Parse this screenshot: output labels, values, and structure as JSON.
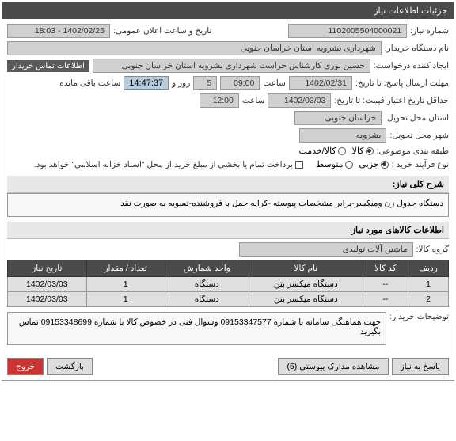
{
  "header": {
    "title": "جزئیات اطلاعات نیاز"
  },
  "fields": {
    "need_no_label": "شماره نیاز:",
    "need_no": "1102005504000021",
    "public_date_label": "تاریخ و ساعت اعلان عمومی:",
    "public_date": "1402/02/25 - 18:03",
    "buyer_label": "نام دستگاه خریدار:",
    "buyer": "شهرداری بشرویه استان خراسان جنوبی",
    "creator_label": "ایجاد کننده درخواست:",
    "creator": "حسین نوری کارشناس حراست شهرداری بشرویه استان خراسان جنوبی",
    "contact_label": "اطلاعات تماس خریدار",
    "deadline_label": "مهلت ارسال پاسخ: تا تاریخ:",
    "deadline_date": "1402/02/31",
    "time_label": "ساعت",
    "deadline_time": "09:00",
    "day_label": "روز و",
    "days_remain": "5",
    "countdown": "14:47:37",
    "remain_label": "ساعت باقی مانده",
    "validity_label": "حداقل تاریخ اعتبار قیمت: تا تاریخ:",
    "validity_date": "1402/03/03",
    "validity_time": "12:00",
    "province_label": "استان محل تحویل:",
    "province": "خراسان جنوبی",
    "city_label": "شهر محل تحویل:",
    "city": "بشرویه",
    "category_label": "طبقه بندی موضوعی:",
    "cat_goods": "کالا",
    "cat_service": "کالا/خدمت",
    "process_label": "نوع فرآیند خرید :",
    "proc_small": "جزیی",
    "proc_medium": "متوسط",
    "payment_note": "پرداخت تمام یا بخشی از مبلغ خرید،از محل \"اسناد خزانه اسلامی\" خواهد بود.",
    "desc_label": "شرح کلی نیاز:",
    "desc_text": "دستگاه جدول زن ومیکسر-برابر مشخصات پیوسته -کرایه حمل با فروشنده-تسویه به صورت نقد",
    "items_section": "اطلاعات کالاهای مورد نیاز",
    "group_label": "گروه کالا:",
    "group_value": "ماشین آلات تولیدی",
    "notes_label": "توضیحات خریدار:",
    "notes_text": "جهت هماهنگی سامانه با شماره 09153347577 وسوال فنی در خصوص کالا با شماره 09153348699 تماس بگیرید"
  },
  "table": {
    "headers": [
      "ردیف",
      "کد کالا",
      "نام کالا",
      "واحد شمارش",
      "تعداد / مقدار",
      "تاریخ نیاز"
    ],
    "rows": [
      [
        "1",
        "--",
        "دستگاه میکسر بتن",
        "دستگاه",
        "1",
        "1402/03/03"
      ],
      [
        "2",
        "--",
        "دستگاه میکسر بتن",
        "دستگاه",
        "1",
        "1402/03/03"
      ]
    ]
  },
  "buttons": {
    "respond": "پاسخ به نیاز",
    "attachments": "مشاهده مدارک پیوستی (5)",
    "back": "بازگشت",
    "exit": "خروج"
  }
}
